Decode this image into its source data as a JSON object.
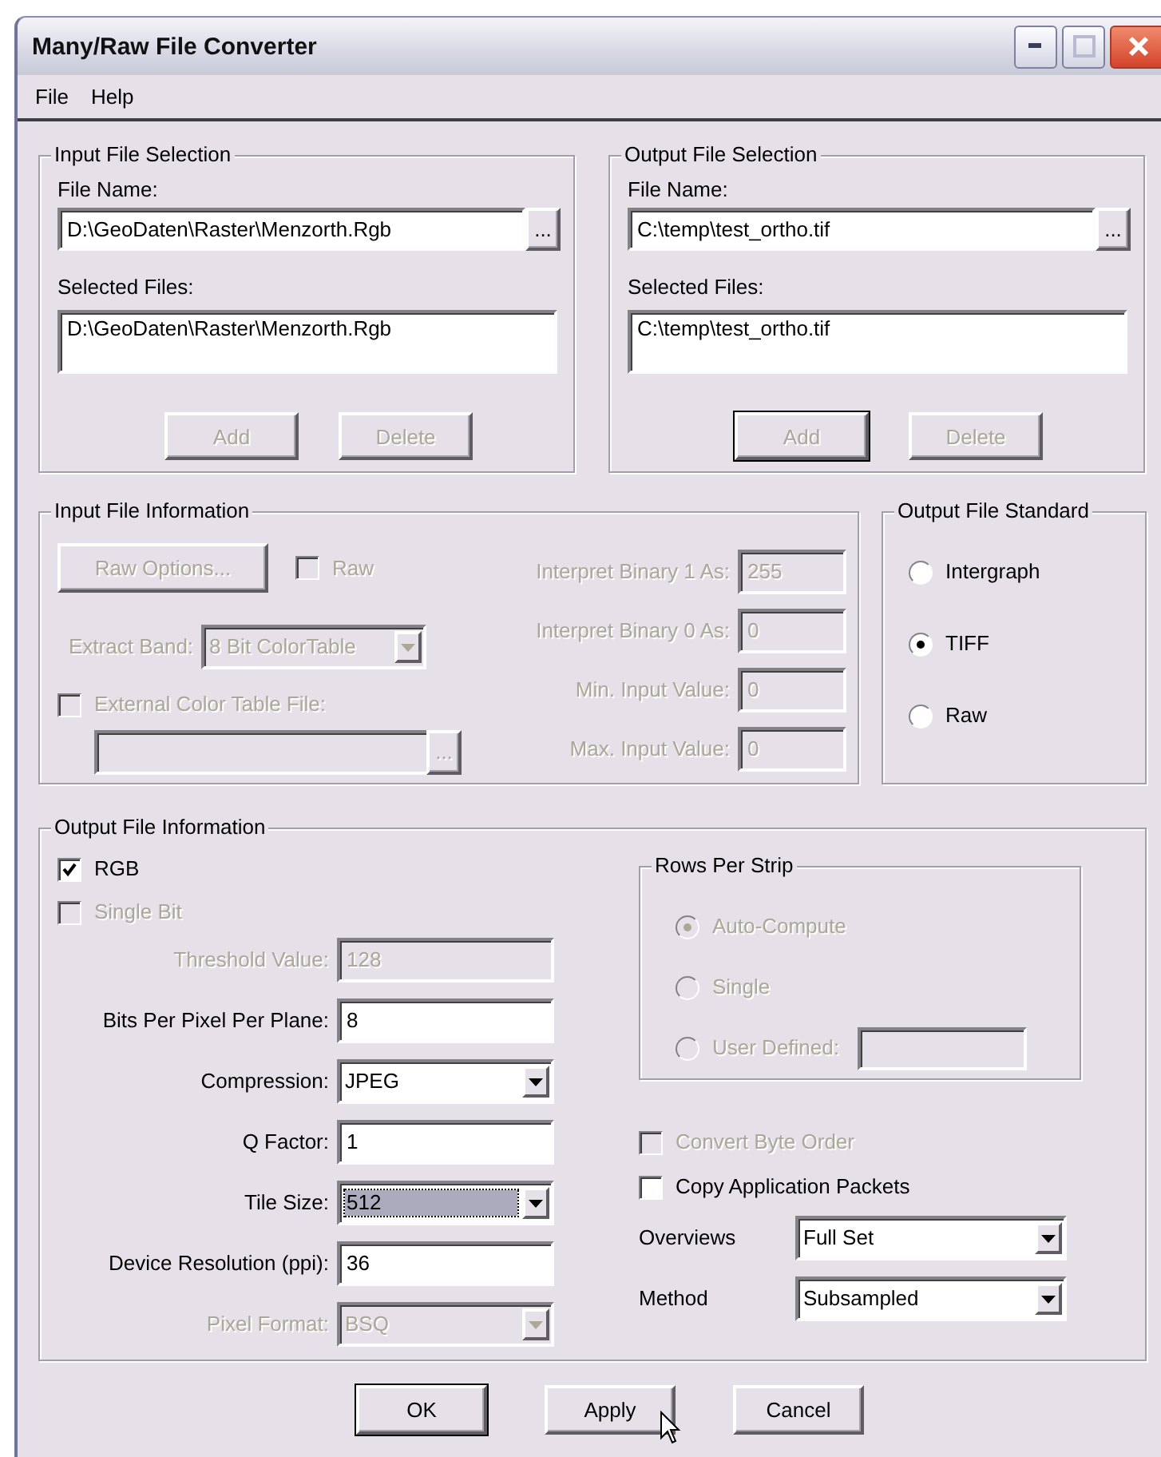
{
  "window": {
    "title": "Many/Raw File Converter"
  },
  "menu": [
    {
      "label": "File"
    },
    {
      "label": "Help"
    }
  ],
  "selection_groups": [
    {
      "title": "Input File Selection",
      "file_name_label": "File Name:",
      "file_name": "D:\\GeoDaten\\Raster\\Menzorth.Rgb",
      "browse": "...",
      "selected_label": "Selected Files:",
      "selected_files": [
        "D:\\GeoDaten\\Raster\\Menzorth.Rgb"
      ],
      "buttons": [
        {
          "label": "Add",
          "disabled": true,
          "default": false
        },
        {
          "label": "Delete",
          "disabled": true,
          "default": false
        }
      ]
    },
    {
      "title": "Output File Selection",
      "file_name_label": "File Name:",
      "file_name": "C:\\temp\\test_ortho.tif",
      "browse": "...",
      "selected_label": "Selected Files:",
      "selected_files": [
        "C:\\temp\\test_ortho.tif"
      ],
      "buttons": [
        {
          "label": "Add",
          "disabled": true,
          "default": true
        },
        {
          "label": "Delete",
          "disabled": true,
          "default": false
        }
      ]
    }
  ],
  "input_info": {
    "title": "Input File Information",
    "raw_options": {
      "label": "Raw Options...",
      "disabled": true
    },
    "raw": {
      "label": "Raw",
      "checked": false,
      "disabled": true
    },
    "extract_band": {
      "label": "Extract Band:",
      "value": "8 Bit ColorTable",
      "disabled": true
    },
    "external": {
      "label": "External Color Table File:",
      "checked": false,
      "disabled": true
    },
    "external_file": {
      "browse": "...",
      "disabled": true
    },
    "fields": [
      {
        "label": "Interpret Binary 1 As:",
        "value": "255",
        "disabled": true
      },
      {
        "label": "Interpret Binary 0 As:",
        "value": "0",
        "disabled": true
      },
      {
        "label": "Min. Input Value:",
        "value": "0",
        "disabled": true
      },
      {
        "label": "Max. Input Value:",
        "value": "0",
        "disabled": true
      }
    ]
  },
  "output_standard": {
    "title": "Output File Standard",
    "options": [
      {
        "label": "Intergraph",
        "selected": false
      },
      {
        "label": "TIFF",
        "selected": true
      },
      {
        "label": "Raw",
        "selected": false
      }
    ]
  },
  "output_info": {
    "title": "Output File Information",
    "checks": [
      {
        "label": "RGB",
        "checked": true,
        "disabled": false
      },
      {
        "label": "Single Bit",
        "checked": false,
        "disabled": true
      }
    ],
    "fields": [
      {
        "kind": "text",
        "label": "Threshold Value:",
        "value": "128",
        "disabled": true,
        "focused": false
      },
      {
        "kind": "text",
        "label": "Bits Per Pixel Per Plane:",
        "value": "8",
        "disabled": false,
        "focused": false
      },
      {
        "kind": "select",
        "label": "Compression:",
        "value": "JPEG",
        "disabled": false,
        "focused": false
      },
      {
        "kind": "text",
        "label": "Q Factor:",
        "value": "1",
        "disabled": false,
        "focused": false
      },
      {
        "kind": "select",
        "label": "Tile Size:",
        "value": "512",
        "disabled": false,
        "focused": true
      },
      {
        "kind": "text",
        "label": "Device Resolution (ppi):",
        "value": "36",
        "disabled": false,
        "focused": false
      },
      {
        "kind": "select",
        "label": "Pixel Format:",
        "value": "BSQ",
        "disabled": true,
        "focused": false
      }
    ],
    "rows_per_strip": {
      "title": "Rows Per Strip",
      "options": [
        {
          "kind": "plain",
          "label": "Auto-Compute",
          "selected": true,
          "disabled": true
        },
        {
          "kind": "plain",
          "label": "Single",
          "selected": false,
          "disabled": true
        },
        {
          "kind": "field",
          "label": "User Defined:",
          "selected": false,
          "disabled": true
        }
      ]
    },
    "right_checks": [
      {
        "label": "Convert Byte Order",
        "checked": false,
        "disabled": true
      },
      {
        "label": "Copy Application Packets",
        "checked": false,
        "disabled": false
      }
    ],
    "right_selects": [
      {
        "label": "Overviews",
        "value": "Full Set"
      },
      {
        "label": "Method",
        "value": "Subsampled"
      }
    ]
  },
  "buttons": [
    {
      "label": "OK",
      "default": true
    },
    {
      "label": "Apply",
      "default": false
    },
    {
      "label": "Cancel",
      "default": false
    }
  ]
}
